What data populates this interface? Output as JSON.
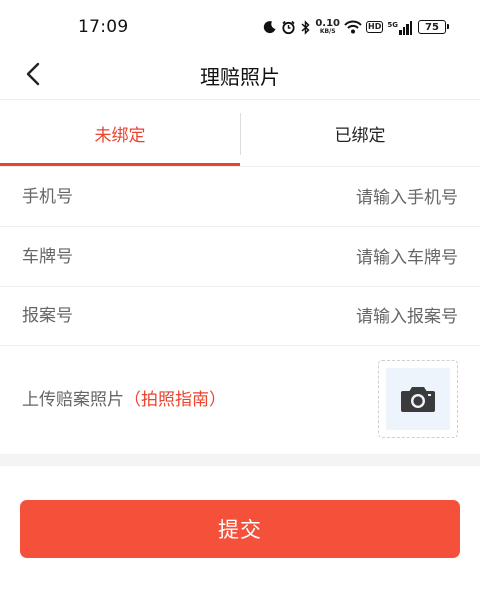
{
  "status_bar": {
    "time": "17:09",
    "net_speed": "0.10",
    "net_unit": "KB/S",
    "hd": "HD",
    "network": "5G",
    "battery": "75"
  },
  "nav": {
    "title": "理赔照片",
    "back_icon": "chevron-left-icon"
  },
  "tabs": [
    {
      "label": "未绑定",
      "active": true
    },
    {
      "label": "已绑定",
      "active": false
    }
  ],
  "form": {
    "phone": {
      "label": "手机号",
      "placeholder": "请输入手机号",
      "value": ""
    },
    "plate": {
      "label": "车牌号",
      "placeholder": "请输入车牌号",
      "value": ""
    },
    "case_no": {
      "label": "报案号",
      "placeholder": "请输入报案号",
      "value": ""
    },
    "upload": {
      "label": "上传赔案照片",
      "guide": "（拍照指南）",
      "icon": "camera-icon"
    }
  },
  "submit": {
    "label": "提交"
  },
  "colors": {
    "accent": "#e8442e",
    "button": "#f5503a",
    "upload_bg": "#eef4fb"
  }
}
